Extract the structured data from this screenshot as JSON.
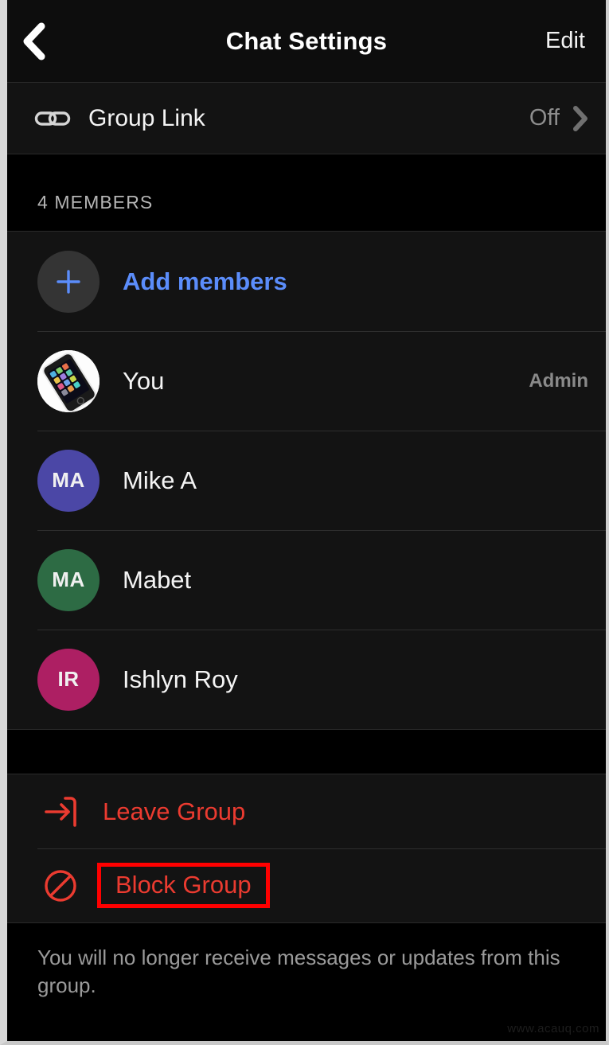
{
  "header": {
    "back_icon": "chevron-left-icon",
    "title": "Chat Settings",
    "edit_label": "Edit"
  },
  "group_link": {
    "icon": "link-icon",
    "label": "Group Link",
    "value": "Off",
    "chevron_icon": "chevron-right-icon"
  },
  "members": {
    "section_title": "4 MEMBERS",
    "add": {
      "icon": "plus-icon",
      "label": "Add members",
      "accent_color": "#5b8dfb"
    },
    "list": [
      {
        "name": "You",
        "initials": "",
        "avatar_type": "photo",
        "avatar_color": "#ffffff",
        "role": "Admin"
      },
      {
        "name": "Mike A",
        "initials": "MA",
        "avatar_type": "initials",
        "avatar_color": "#4b47a6",
        "role": ""
      },
      {
        "name": "Mabet",
        "initials": "MA",
        "avatar_type": "initials",
        "avatar_color": "#2d6b44",
        "role": ""
      },
      {
        "name": "Ishlyn Roy",
        "initials": "IR",
        "avatar_type": "initials",
        "avatar_color": "#ad1f63",
        "role": ""
      }
    ]
  },
  "actions": {
    "leave": {
      "icon": "exit-door-icon",
      "label": "Leave Group"
    },
    "block": {
      "icon": "block-circle-slash-icon",
      "label": "Block Group",
      "highlight_color": "#ff0000"
    },
    "danger_color": "#eb3b30"
  },
  "footer": {
    "note": "You will no longer receive messages or updates from this group."
  },
  "watermark": {
    "text": "www.acauq.com"
  }
}
